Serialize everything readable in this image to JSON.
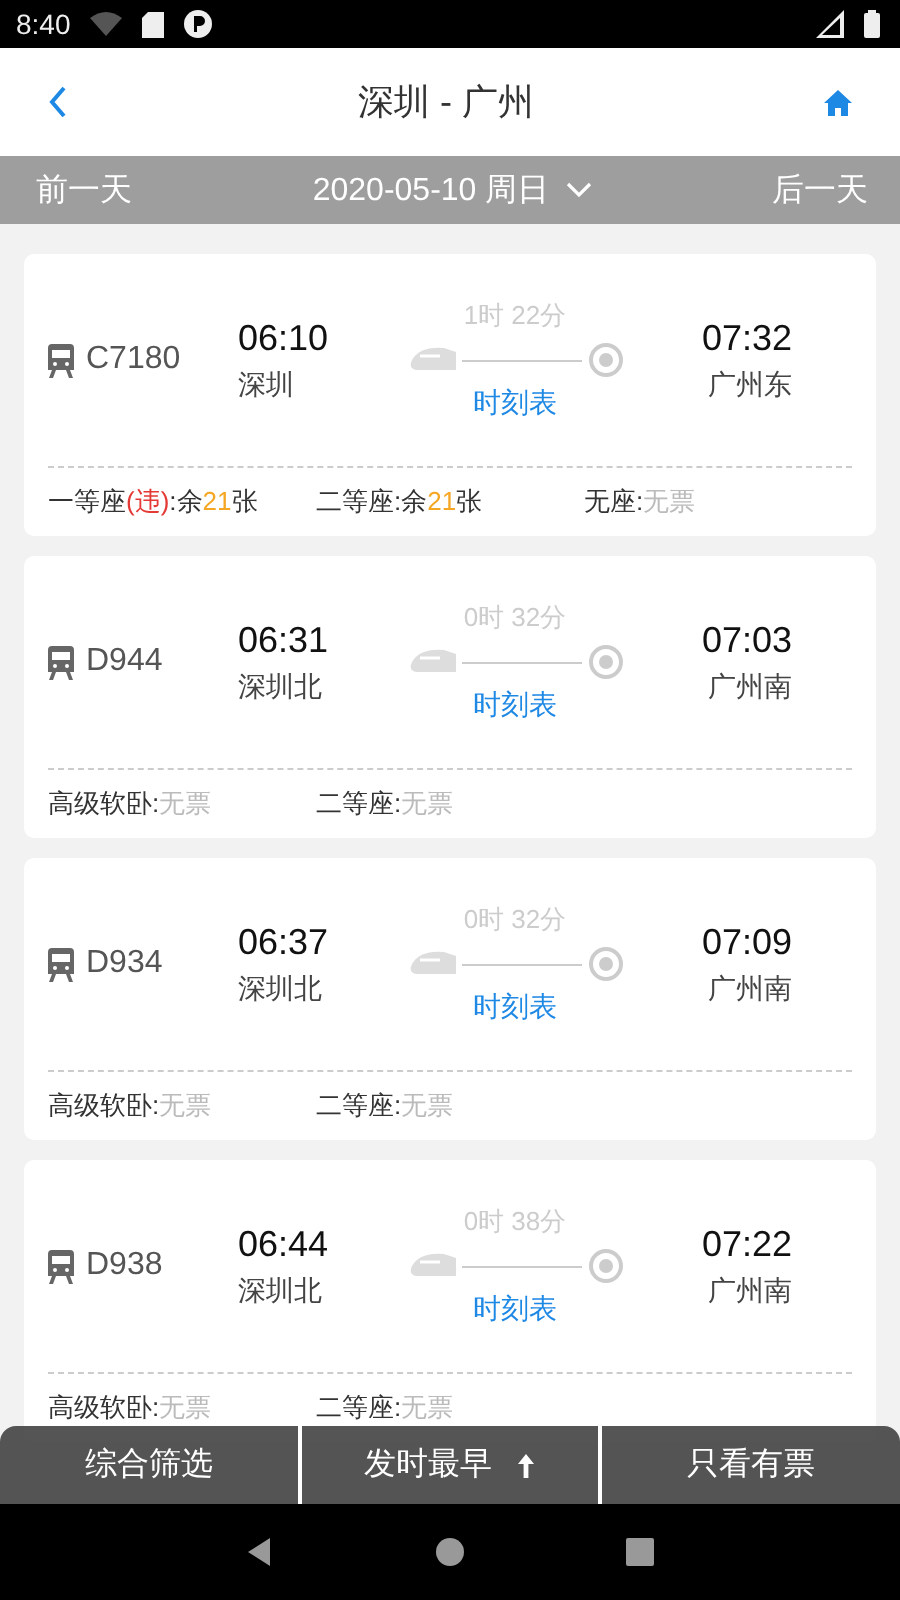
{
  "status_bar": {
    "time": "8:40"
  },
  "header": {
    "title": "深圳 - 广州"
  },
  "date_bar": {
    "prev": "前一天",
    "date": "2020-05-10 周日",
    "next": "后一天"
  },
  "trains": [
    {
      "number": "C7180",
      "depart_time": "06:10",
      "depart_station": "深圳",
      "duration": "1时 22分",
      "timetable": "时刻表",
      "arrive_time": "07:32",
      "arrive_station": "广州东",
      "seats": [
        {
          "label": "一等座",
          "note": "(违)",
          "kind": "count",
          "before": ":余",
          "count": "21",
          "after": "张"
        },
        {
          "label": "二等座",
          "kind": "count",
          "before": ":余",
          "count": "21",
          "after": "张"
        },
        {
          "label": "无座:",
          "kind": "none",
          "status": "无票"
        }
      ]
    },
    {
      "number": "D944",
      "depart_time": "06:31",
      "depart_station": "深圳北",
      "duration": "0时 32分",
      "timetable": "时刻表",
      "arrive_time": "07:03",
      "arrive_station": "广州南",
      "seats": [
        {
          "label": "高级软卧:",
          "kind": "none",
          "status": "无票"
        },
        {
          "label": "二等座:",
          "kind": "none",
          "status": "无票"
        }
      ]
    },
    {
      "number": "D934",
      "depart_time": "06:37",
      "depart_station": "深圳北",
      "duration": "0时 32分",
      "timetable": "时刻表",
      "arrive_time": "07:09",
      "arrive_station": "广州南",
      "seats": [
        {
          "label": "高级软卧:",
          "kind": "none",
          "status": "无票"
        },
        {
          "label": "二等座:",
          "kind": "none",
          "status": "无票"
        }
      ]
    },
    {
      "number": "D938",
      "depart_time": "06:44",
      "depart_station": "深圳北",
      "duration": "0时 38分",
      "timetable": "时刻表",
      "arrive_time": "07:22",
      "arrive_station": "广州南",
      "seats": [
        {
          "label": "高级软卧:",
          "kind": "none",
          "status": "无票"
        },
        {
          "label": "二等座:",
          "kind": "none",
          "status": "无票"
        }
      ]
    }
  ],
  "filter_bar": [
    {
      "label": "综合筛选",
      "kind": "plain"
    },
    {
      "label": "发时最早",
      "kind": "sort"
    },
    {
      "label": "只看有票",
      "kind": "plain"
    }
  ]
}
